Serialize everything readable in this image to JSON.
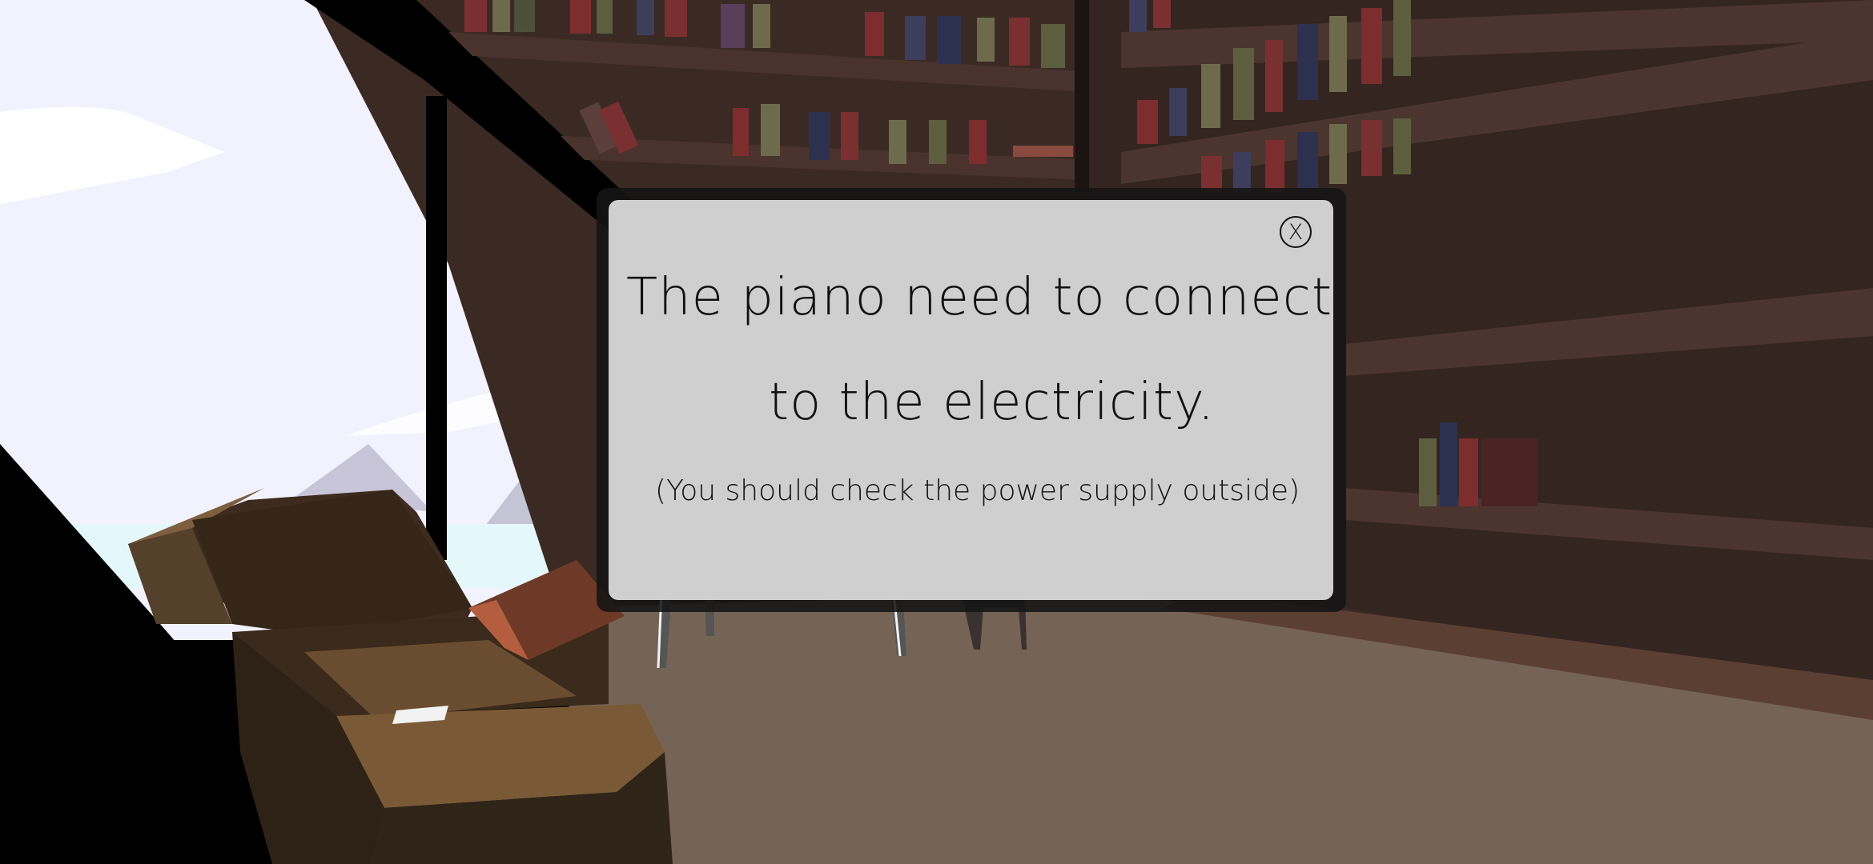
{
  "dialog": {
    "message_line_1": "The piano need to connect",
    "message_line_2": "to the electricity.",
    "hint": "(You should check the power supply outside)",
    "close_label": "X"
  },
  "icons": {
    "close": "close-circle-icon"
  },
  "colors": {
    "dialog_background": "#dedede",
    "dialog_frame": "#1a1a1a",
    "text": "#111111",
    "floor": "#756456",
    "sky": "#f2f2ff",
    "shelf_wood": "#3f2c26"
  }
}
